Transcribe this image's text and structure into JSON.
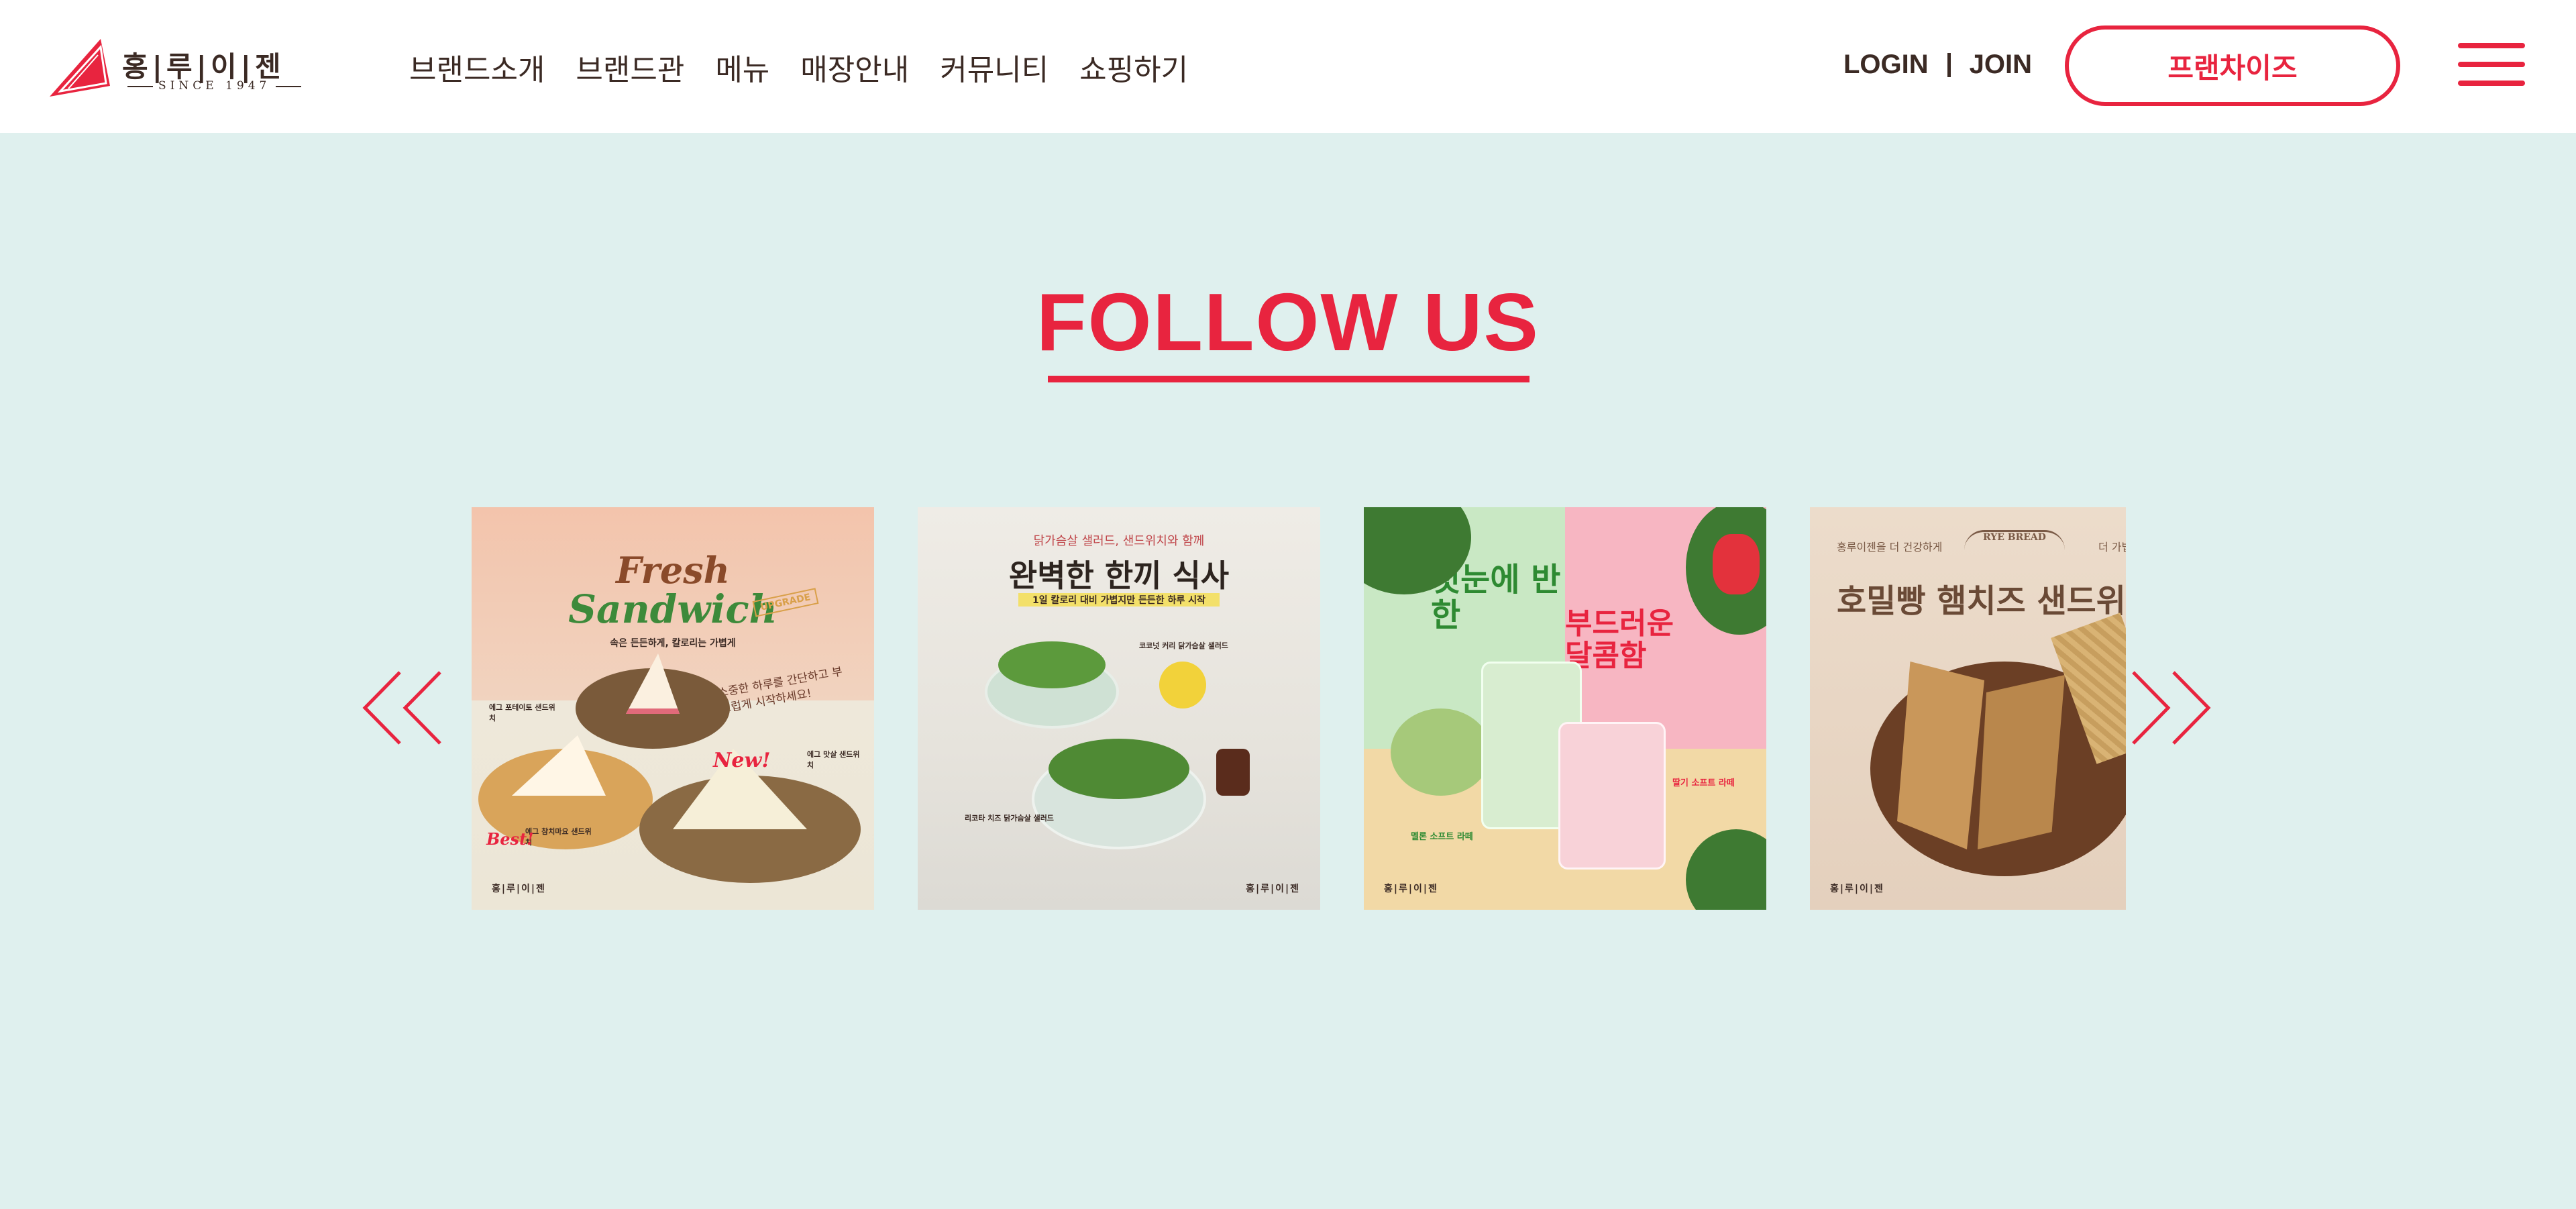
{
  "header": {
    "logo": {
      "title": "홍|루|이|젠",
      "since": "SINCE 1947"
    },
    "nav": [
      {
        "label": "브랜드소개"
      },
      {
        "label": "브랜드관"
      },
      {
        "label": "메뉴"
      },
      {
        "label": "매장안내"
      },
      {
        "label": "커뮤니티"
      },
      {
        "label": "쇼핑하기"
      }
    ],
    "auth": {
      "login": "LOGIN",
      "join": "JOIN"
    },
    "franchise_label": "프랜차이즈"
  },
  "follow": {
    "title": "FOLLOW US",
    "posts": [
      {
        "title_line1": "Fresh",
        "title_line2": "Sandwich",
        "badge": "UPGRADE",
        "subtitle": "속은 든든하게, 칼로리는 가볍게",
        "callout": "소중한 하루를 간단하고 부드럽게 시작하세요!",
        "items": [
          "에그 포테이토 샌드위치",
          "에그 맛살 샌드위치",
          "에그 참치마요 샌드위치"
        ],
        "tags": [
          "New!",
          "Best!"
        ],
        "brand": "홍|루|이|젠"
      },
      {
        "kicker": "닭가슴살 샐러드, 샌드위치와 함께",
        "title": "완벽한 한끼 식사",
        "highlight": "1일 칼로리 대비 가볍지만 든든한 하루 시작",
        "items": [
          "코코넛 커리 닭가슴살 샐러드",
          "리코타 치즈 닭가슴살 샐러드"
        ],
        "brand": "홍|루|이|젠"
      },
      {
        "title_left": "첫눈에 반한",
        "title_right": "부드러운 달콤함",
        "items": [
          "멜론 소프트 라떼",
          "딸기 소프트 라떼"
        ],
        "brand": "홍|루|이|젠"
      },
      {
        "kicker": "홍루이젠을 더 건강하게",
        "badge": "RYE BREAD",
        "kicker_right": "더 가볍게",
        "title": "호밀빵 햄치즈 샌드위치",
        "brand": "홍|루|이|젠"
      }
    ]
  },
  "colors": {
    "accent": "#e8243f",
    "background": "#dff0ee",
    "text": "#3b2a24"
  },
  "icons": {
    "logo": "sandwich-logo-icon",
    "prev": "double-chevron-left-icon",
    "next": "double-chevron-right-icon",
    "menu": "hamburger-icon"
  }
}
